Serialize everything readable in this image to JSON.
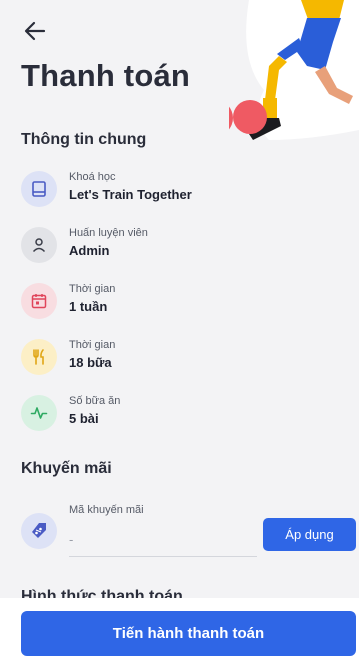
{
  "header": {
    "back_icon": "arrow-left-icon",
    "title": "Thanh toán"
  },
  "general": {
    "section_title": "Thông tin chung",
    "items": [
      {
        "icon": "book-icon",
        "color": "#4a5bc4",
        "bg": "#dde2f6",
        "label": "Khoá học",
        "value": "Let's Train Together"
      },
      {
        "icon": "user-icon",
        "color": "#3a3d48",
        "bg": "#e2e3e7",
        "label": "Huấn luyện viên",
        "value": "Admin"
      },
      {
        "icon": "calendar-icon",
        "color": "#e0455a",
        "bg": "#f8dde1",
        "label": "Thời gian",
        "value": "1 tuần"
      },
      {
        "icon": "fork-knife-icon",
        "color": "#e0a615",
        "bg": "#fcefc6",
        "label": "Thời gian",
        "value": "18 bữa"
      },
      {
        "icon": "activity-icon",
        "color": "#2eaa62",
        "bg": "#d8f1e2",
        "label": "Số bữa ăn",
        "value": "5 bài"
      }
    ]
  },
  "promotion": {
    "section_title": "Khuyến mãi",
    "icon": "discount-tag-icon",
    "field_label": "Mã khuyến mãi",
    "placeholder": "-",
    "value": "",
    "apply_label": "Áp dụng"
  },
  "payment_method": {
    "section_title": "Hình thức thanh toán"
  },
  "cta": {
    "label": "Tiến hành thanh toán"
  },
  "colors": {
    "accent": "#2f66e6",
    "panel_bg": "#f3f3f5"
  }
}
